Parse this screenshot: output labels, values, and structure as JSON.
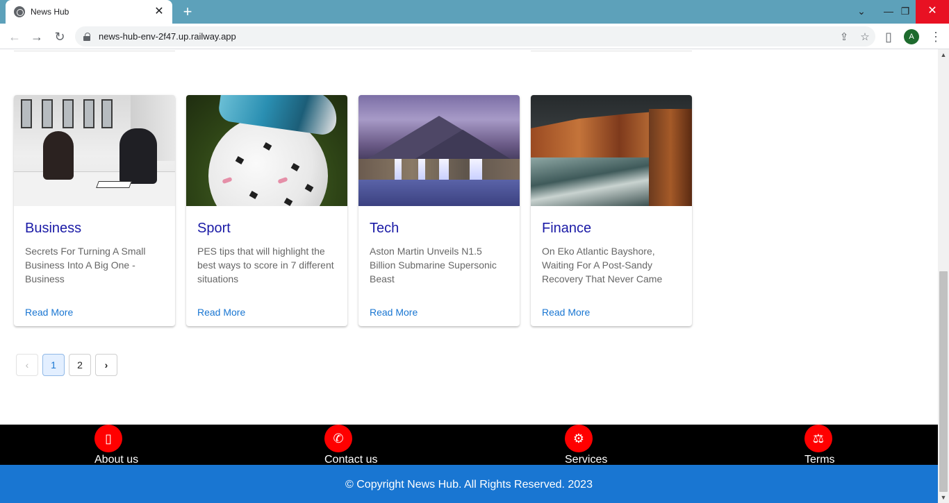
{
  "browser": {
    "tab_title": "News Hub",
    "tab_close": "✕",
    "new_tab": "+",
    "url": "news-hub-env-2f47.up.railway.app",
    "profile_initial": "A",
    "controls": {
      "dropdown": "⌄",
      "minimize": "—",
      "restore": "❐",
      "close": "✕"
    },
    "nav": {
      "back": "←",
      "forward": "→",
      "reload": "↻"
    },
    "omnibox_icons": {
      "share": "⇪",
      "bookmark": "☆",
      "sidepanel": "▯"
    }
  },
  "cards": [
    {
      "category": "Business",
      "description": "Secrets For Turning A Small Business Into A Big One - Business",
      "link": "Read More"
    },
    {
      "category": "Sport",
      "description": "PES tips that will highlight the best ways to score in 7 different situations",
      "link": "Read More"
    },
    {
      "category": "Tech",
      "description": "Aston Martin Unveils N1.5 Billion Submarine Supersonic Beast",
      "link": "Read More"
    },
    {
      "category": "Finance",
      "description": "On Eko Atlantic Bayshore, Waiting For A Post-Sandy Recovery That Never Came",
      "link": "Read More"
    }
  ],
  "pagination": {
    "prev": "‹",
    "pages": [
      "1",
      "2"
    ],
    "current": "1",
    "next": "›"
  },
  "footer": {
    "nav": [
      {
        "label": "About us",
        "icon": "mobile-settings-icon",
        "glyph": "▯"
      },
      {
        "label": "Contact us",
        "icon": "phone-add-icon",
        "glyph": "✆"
      },
      {
        "label": "Services",
        "icon": "delivery-scooter-icon",
        "glyph": "⚙"
      },
      {
        "label": "Terms",
        "icon": "scales-icon",
        "glyph": "⚖"
      }
    ],
    "copyright": "© Copyright News Hub. All Rights Reserved. 2023"
  },
  "colors": {
    "tabstrip": "#5da1ba",
    "category": "#1a1aa6",
    "link": "#1976d2",
    "footer_icon": "#ff0000",
    "footer_bar": "#1976d2"
  }
}
